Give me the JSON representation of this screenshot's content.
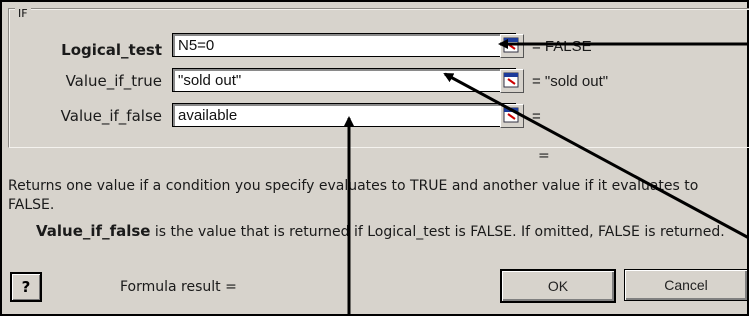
{
  "dialog": {
    "group_title": "IF",
    "arguments": [
      {
        "label": "Logical_test",
        "value": "N5=0",
        "result": "= FALSE",
        "bold": true
      },
      {
        "label": "Value_if_true",
        "value": "\"sold out\"",
        "result": "= \"sold out\"",
        "bold": false
      },
      {
        "label": "Value_if_false",
        "value": "available",
        "result": "=",
        "bold": false
      }
    ],
    "equals_result": "=",
    "description": "Returns one value if a condition you specify evaluates to TRUE and another value if it evaluates to FALSE.",
    "arg_desc_name": "Value_if_false",
    "arg_desc_text": " is the value that is returned if Logical_test is FALSE. If omitted, FALSE is returned.",
    "help_label": "?",
    "formula_result_label": "Formula result =",
    "ok_label": "OK",
    "cancel_label": "Cancel"
  },
  "icons": [
    "collapse-dialog-icon",
    "help-icon"
  ]
}
